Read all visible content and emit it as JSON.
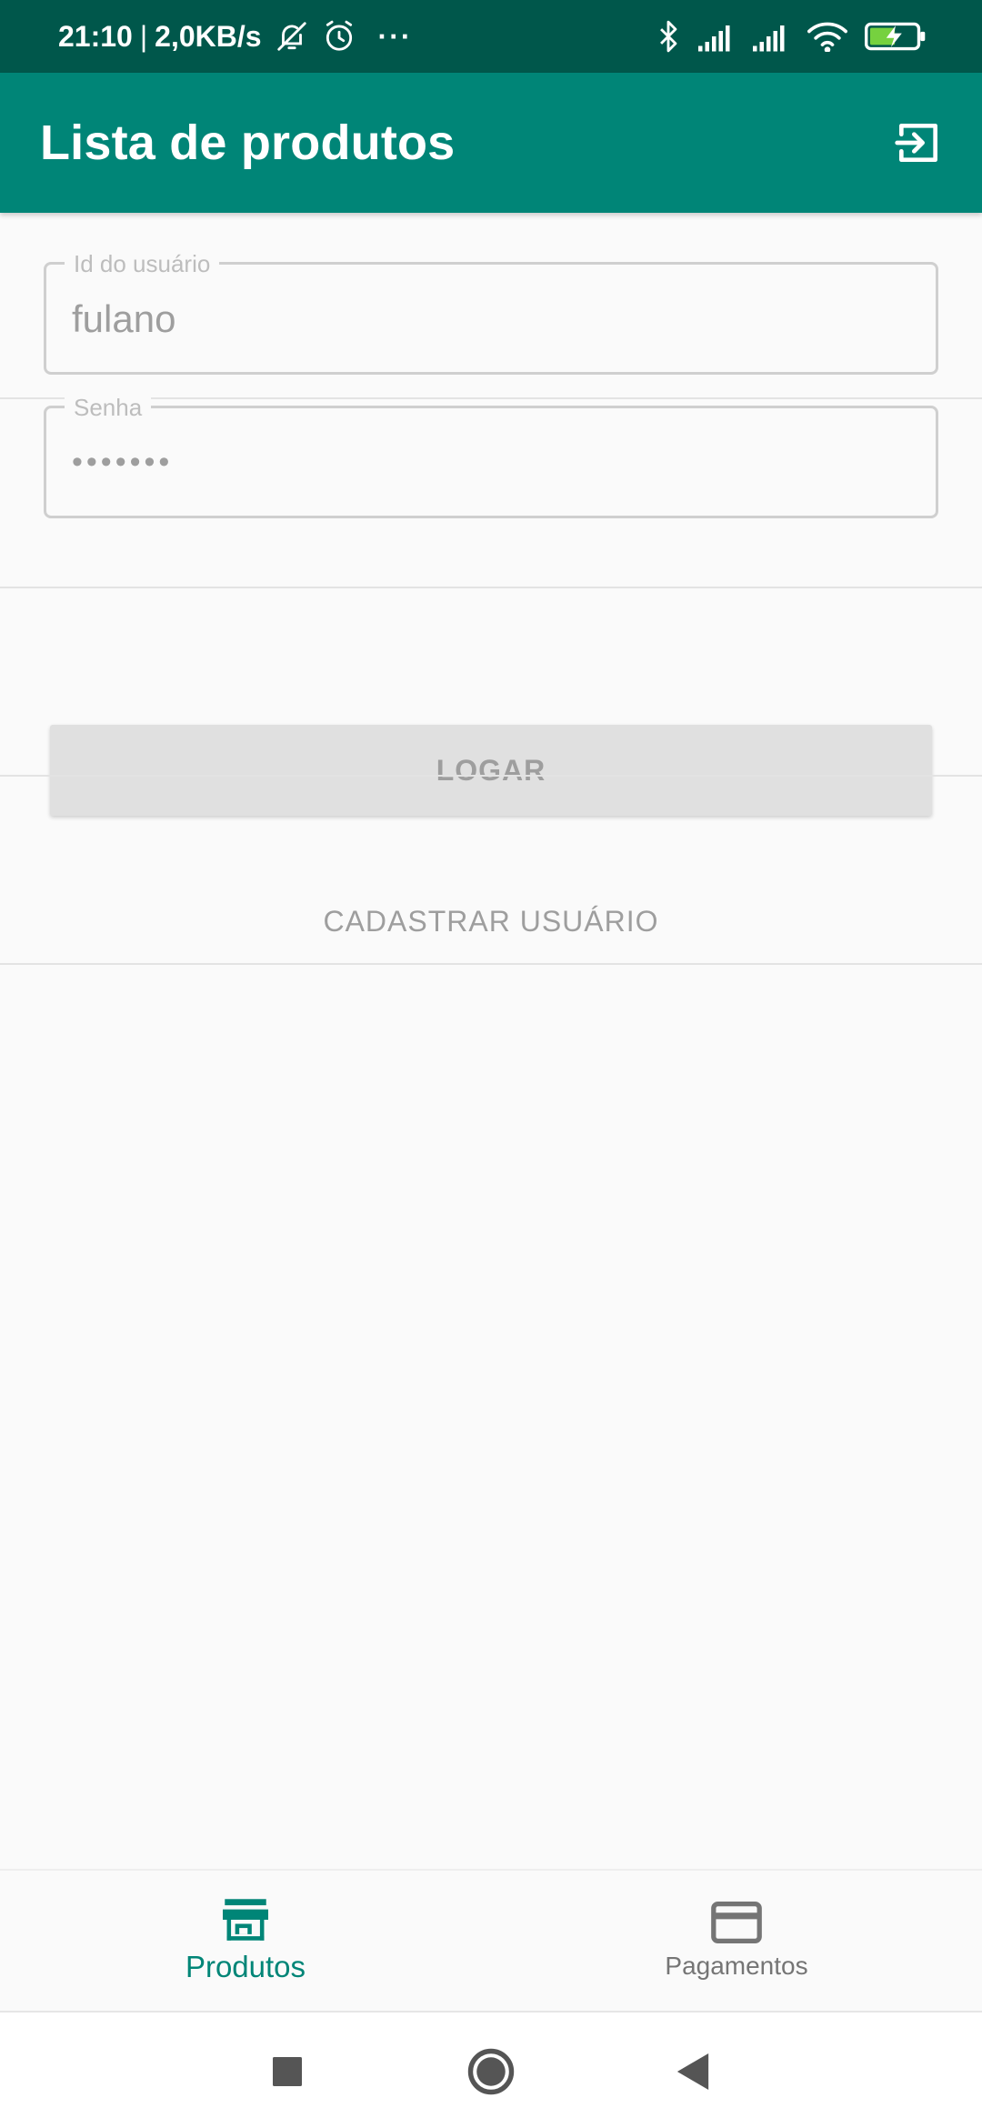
{
  "status_bar": {
    "time": "21:10",
    "separator": "|",
    "speed": "2,0KB/s",
    "more": "···",
    "icons": [
      "bell-off-icon",
      "alarm-icon",
      "bluetooth-icon",
      "signal-icon",
      "signal-icon",
      "wifi-icon",
      "battery-charging-icon"
    ]
  },
  "app_bar": {
    "title": "Lista de produtos",
    "action_icon": "logout-icon"
  },
  "form": {
    "user_id": {
      "label": "Id do usuário",
      "value": "fulano"
    },
    "password": {
      "label": "Senha",
      "value": "•••••••"
    }
  },
  "buttons": {
    "login": "LOGAR",
    "register": "CADASTRAR USUÁRIO"
  },
  "bottom_nav": {
    "items": [
      {
        "label": "Produtos",
        "icon": "store-icon",
        "active": true
      },
      {
        "label": "Pagamentos",
        "icon": "credit-card-icon",
        "active": false
      }
    ]
  },
  "system_nav": {
    "icons": [
      "recents-square-icon",
      "home-circle-icon",
      "back-triangle-icon"
    ]
  },
  "colors": {
    "primary": "#008577",
    "primary_dark": "#00574b",
    "disabled_text": "#9e9e9e",
    "background": "#fafafa"
  }
}
